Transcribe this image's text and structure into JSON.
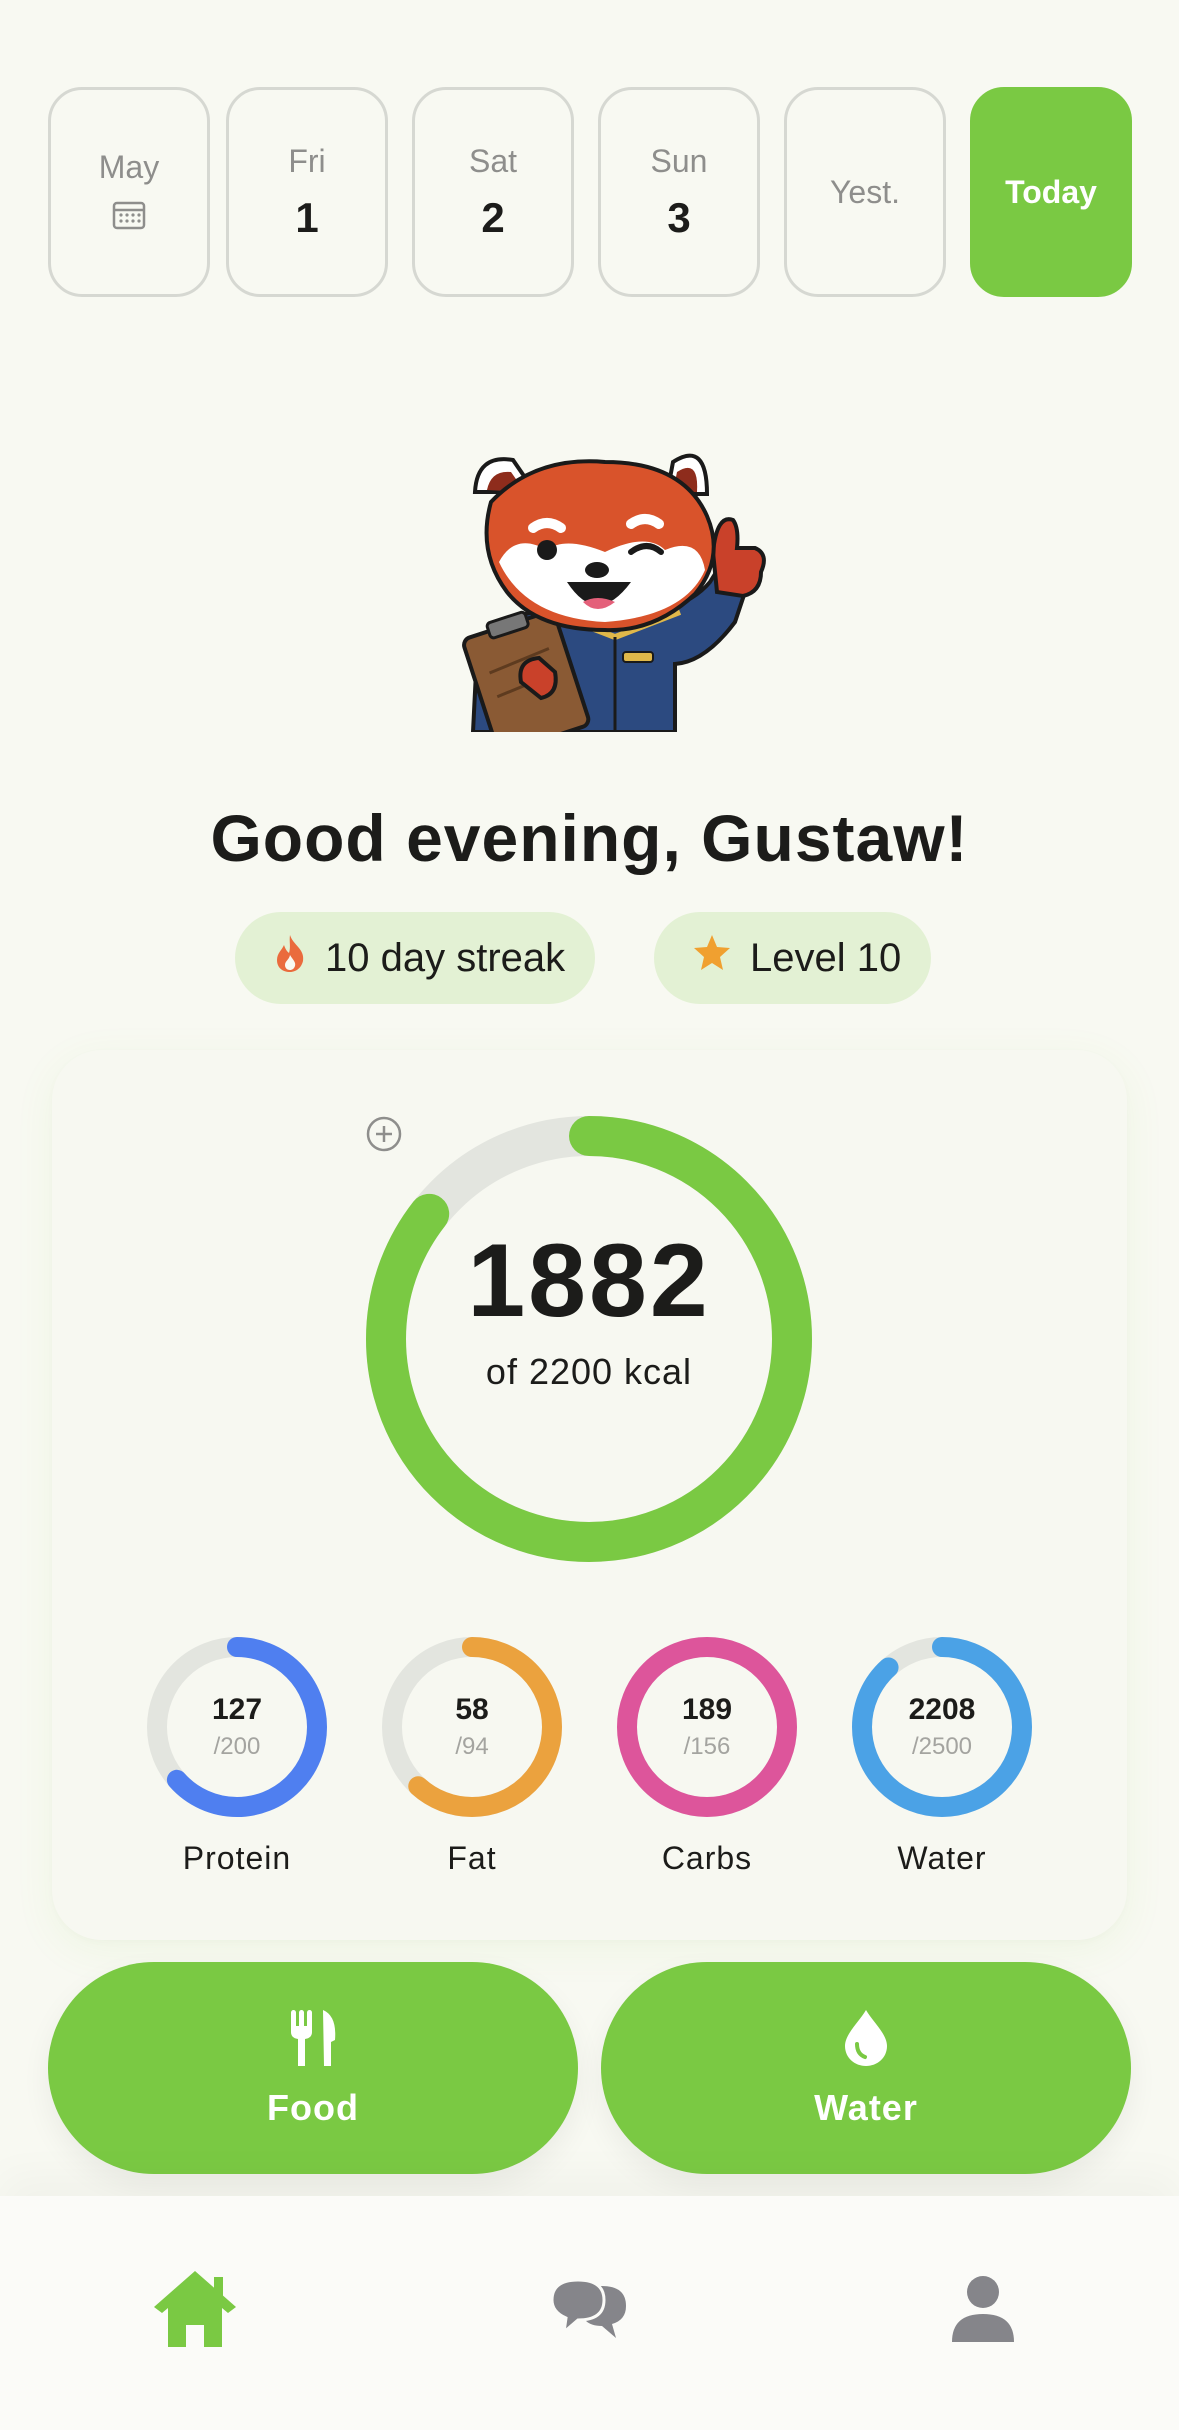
{
  "dates": [
    {
      "dow": "May",
      "num": "",
      "icon": "calendar-icon",
      "active": false
    },
    {
      "dow": "Fri",
      "num": "1",
      "active": false
    },
    {
      "dow": "Sat",
      "num": "2",
      "active": false
    },
    {
      "dow": "Sun",
      "num": "3",
      "active": false
    },
    {
      "dow": "Yest.",
      "num": "",
      "active": false
    },
    {
      "dow": "Today",
      "num": "",
      "active": true
    }
  ],
  "greeting": "Good evening, Gustaw!",
  "badges": {
    "streak": {
      "icon": "flame-icon",
      "label": "10 day streak"
    },
    "level": {
      "icon": "star-icon",
      "label": "Level 10"
    }
  },
  "calories": {
    "value": "1882",
    "goal_label": "of 2200 kcal",
    "consumed": 1882,
    "goal": 2200,
    "add_icon": "plus-circle-icon"
  },
  "macros": [
    {
      "name": "Protein",
      "value": "127",
      "goal": "/200",
      "current": 127,
      "target": 200,
      "color": "#4f7ff0"
    },
    {
      "name": "Fat",
      "value": "58",
      "goal": "/94",
      "current": 58,
      "target": 94,
      "color": "#eba23e"
    },
    {
      "name": "Carbs",
      "value": "189",
      "goal": "/156",
      "current": 189,
      "target": 156,
      "color": "#dd559b"
    },
    {
      "name": "Water",
      "value": "2208",
      "goal": "/2500",
      "current": 2208,
      "target": 2500,
      "color": "#4ba2e6"
    }
  ],
  "actions": {
    "food": {
      "label": "Food",
      "icon": "fork-knife-icon"
    },
    "water": {
      "label": "Water",
      "icon": "water-drop-icon"
    }
  },
  "nav": [
    {
      "name": "home",
      "icon": "home-icon",
      "active": true
    },
    {
      "name": "chat",
      "icon": "chat-bubbles-icon",
      "active": false
    },
    {
      "name": "profile",
      "icon": "person-icon",
      "active": false
    }
  ],
  "colors": {
    "accent": "#7ac943",
    "track": "#e3e5df",
    "background": "#f8f9f2"
  }
}
